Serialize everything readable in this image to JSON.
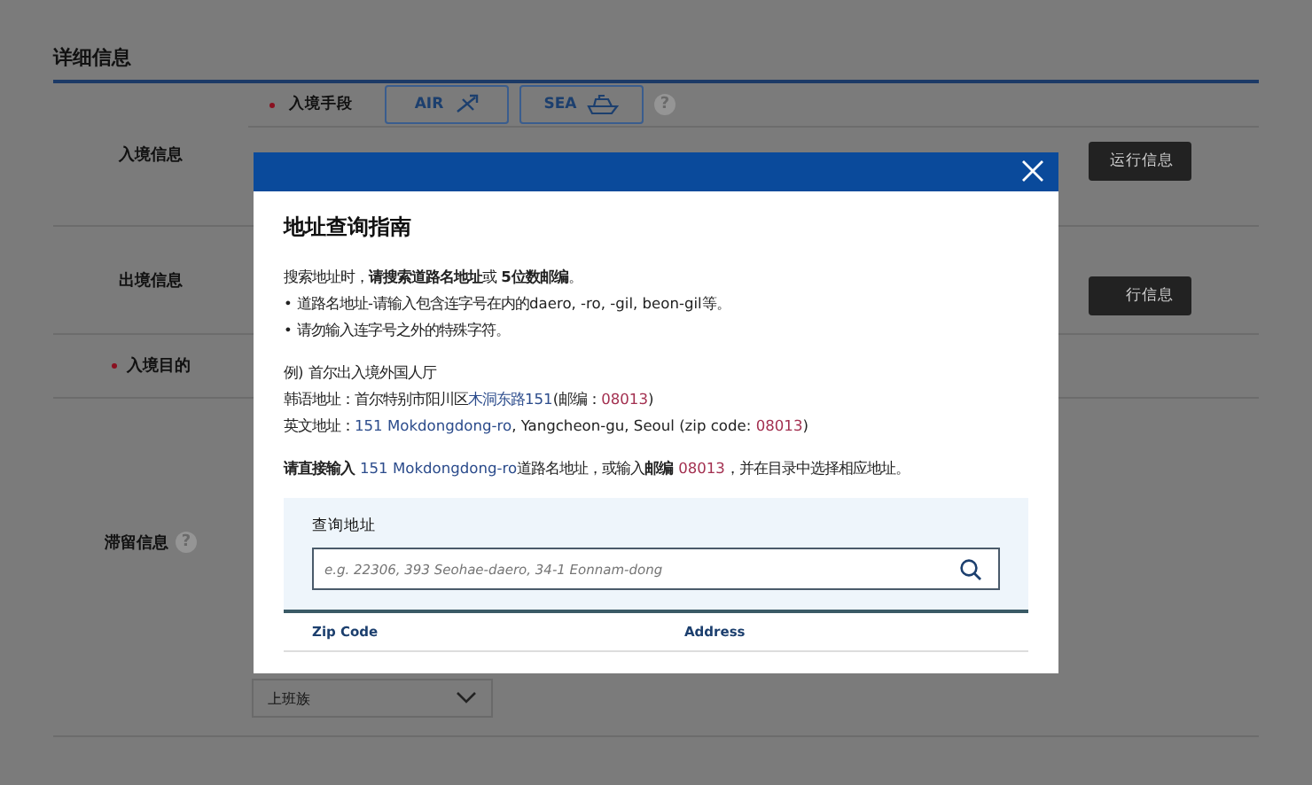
{
  "page": {
    "section_title": "详细信息",
    "rows": [
      {
        "label": "入境信息",
        "required": false,
        "fields": [
          {
            "kind": "transport",
            "label": "入境手段",
            "required": true,
            "options": [
              {
                "label": "AIR"
              },
              {
                "label": "SEA"
              }
            ],
            "help": "?"
          },
          {
            "kind": "button",
            "label": "运行信息"
          }
        ]
      },
      {
        "label": "出境信息",
        "required": false,
        "fields": [
          {
            "kind": "button",
            "label": "行信息"
          }
        ]
      },
      {
        "label": "入境目的",
        "required": true,
        "fields": []
      },
      {
        "label": "滞留信息",
        "required": false,
        "help": "?",
        "fields": [
          {
            "kind": "select",
            "value": "上班族"
          }
        ]
      }
    ]
  },
  "modal": {
    "title": "地址查询指南",
    "paragraphs": [
      [
        [
          {
            "kind": "plain",
            "text": "搜索地址时，"
          },
          {
            "kind": "bold",
            "text": "请搜索道路名地址"
          },
          {
            "kind": "plain",
            "text": "或 "
          },
          {
            "kind": "bold",
            "text": "5位数邮编"
          },
          {
            "kind": "plain",
            "text": "。"
          }
        ],
        [
          {
            "kind": "plain",
            "text": "• 道路名地址-请输入包含连字号在内的daero, -ro, -gil, beon-gil等。"
          }
        ],
        [
          {
            "kind": "plain",
            "text": "• 请勿输入连字号之外的特殊字符。"
          }
        ]
      ],
      [
        [
          {
            "kind": "plain",
            "text": "例) 首尔出入境外国人厅"
          }
        ],
        [
          {
            "kind": "plain",
            "text": "韩语地址：首尔特别市阳川区"
          },
          {
            "kind": "road",
            "text": "木洞东路151"
          },
          {
            "kind": "plain",
            "text": "(邮编："
          },
          {
            "kind": "zip",
            "text": "08013"
          },
          {
            "kind": "plain",
            "text": ")"
          }
        ],
        [
          {
            "kind": "plain",
            "text": "英文地址："
          },
          {
            "kind": "road",
            "text": "151 Mokdongdong-ro"
          },
          {
            "kind": "plain",
            "text": ", Yangcheon-gu, Seoul (zip code: "
          },
          {
            "kind": "zip",
            "text": "08013"
          },
          {
            "kind": "plain",
            "text": ")"
          }
        ]
      ],
      [
        [
          {
            "kind": "bold",
            "text": "请直接输入"
          },
          {
            "kind": "road",
            "text": "151 Mokdongdong-ro"
          },
          {
            "kind": "plain",
            "text": "道路名地址，或输入"
          },
          {
            "kind": "bold",
            "text": "邮编"
          },
          {
            "kind": "zip",
            "text": "08013"
          },
          {
            "kind": "plain",
            "text": "，并在目录中选择相应地址。"
          }
        ]
      ]
    ],
    "search": {
      "label": "查询地址",
      "placeholder": "e.g. 22306, 393 Seohae-daero, 34-1 Eonnam-dong"
    },
    "table": {
      "columns": [
        "Zip Code",
        "Address"
      ]
    }
  }
}
